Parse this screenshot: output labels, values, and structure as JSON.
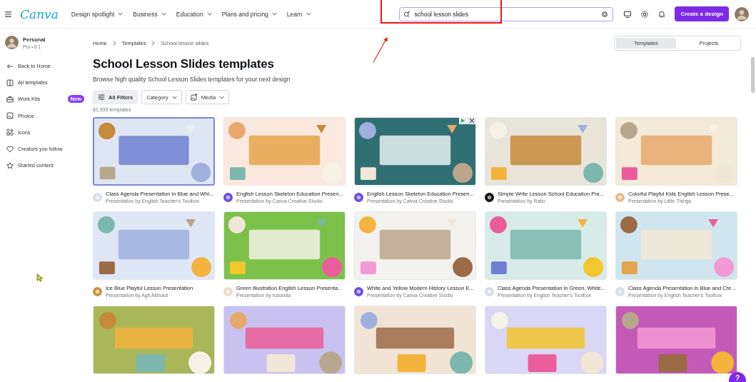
{
  "topbar": {
    "logo": "Canva",
    "nav": [
      {
        "label": "Design spotlight"
      },
      {
        "label": "Business"
      },
      {
        "label": "Education"
      },
      {
        "label": "Plans and pricing"
      },
      {
        "label": "Learn"
      }
    ],
    "search": {
      "value": "school lesson slides"
    },
    "create_button": "Create a design"
  },
  "sidebar": {
    "account": {
      "name": "Personal",
      "plan": "Pro • 8 1"
    },
    "items": [
      {
        "label": "Back to Home"
      },
      {
        "label": "All templates"
      },
      {
        "label": "Work Kits",
        "badge": "New"
      },
      {
        "label": "Photos"
      },
      {
        "label": "Icons"
      },
      {
        "label": "Creators you follow"
      },
      {
        "label": "Starred content"
      }
    ]
  },
  "breadcrumb": [
    "Home",
    "Templates",
    "School lesson slides"
  ],
  "view_toggle": [
    {
      "label": "Templates",
      "selected": true
    },
    {
      "label": "Projects",
      "selected": false
    }
  ],
  "title": "School Lesson Slides templates",
  "subtitle": "Browse high quality School Lesson Slides templates for your next design",
  "filters": [
    {
      "label": "All Filters",
      "kind": "primary"
    },
    {
      "label": "Category",
      "kind": "dropdown"
    },
    {
      "label": "Media",
      "kind": "media"
    }
  ],
  "count": "81,939 templates",
  "templates": [
    {
      "title": "Class Agenda Presentation in Blue and Whi...",
      "author": "Presentation by English Teacher's Toolbox",
      "selected": true
    },
    {
      "title": "English Lesson Skeleton Education Presen...",
      "author": "Presentation by Canva Creative Studio",
      "selected": false
    },
    {
      "title": "English Lesson Skeleton Education Presen...",
      "author": "Presentation by Canva Creative Studio",
      "selected": false
    },
    {
      "title": "Simple Write Lesson School Education Pre...",
      "author": "Presentation by Ratio",
      "selected": false
    },
    {
      "title": "Colorful Playful Kids English Lesson Prese...",
      "author": "Presentation by Little Things",
      "selected": false
    },
    {
      "title": "Ice Blue Playful Lesson Presentation",
      "author": "Presentation by Agit Akbulut",
      "selected": false
    },
    {
      "title": "Green Illustration English Lesson Presenta...",
      "author": "Presentation by ruisaxila",
      "selected": false
    },
    {
      "title": "White and Yellow Modern History Lesson E...",
      "author": "Presentation by Canva Creative Studio",
      "selected": false
    },
    {
      "title": "Class Agenda Presentation in Green, White...",
      "author": "Presentation by English Teacher's Toolbox",
      "selected": false
    },
    {
      "title": "Class Agenda Presentation in Blue and Cre...",
      "author": "Presentation by English Teacher's Toolbox",
      "selected": false
    }
  ],
  "help_button": "?"
}
